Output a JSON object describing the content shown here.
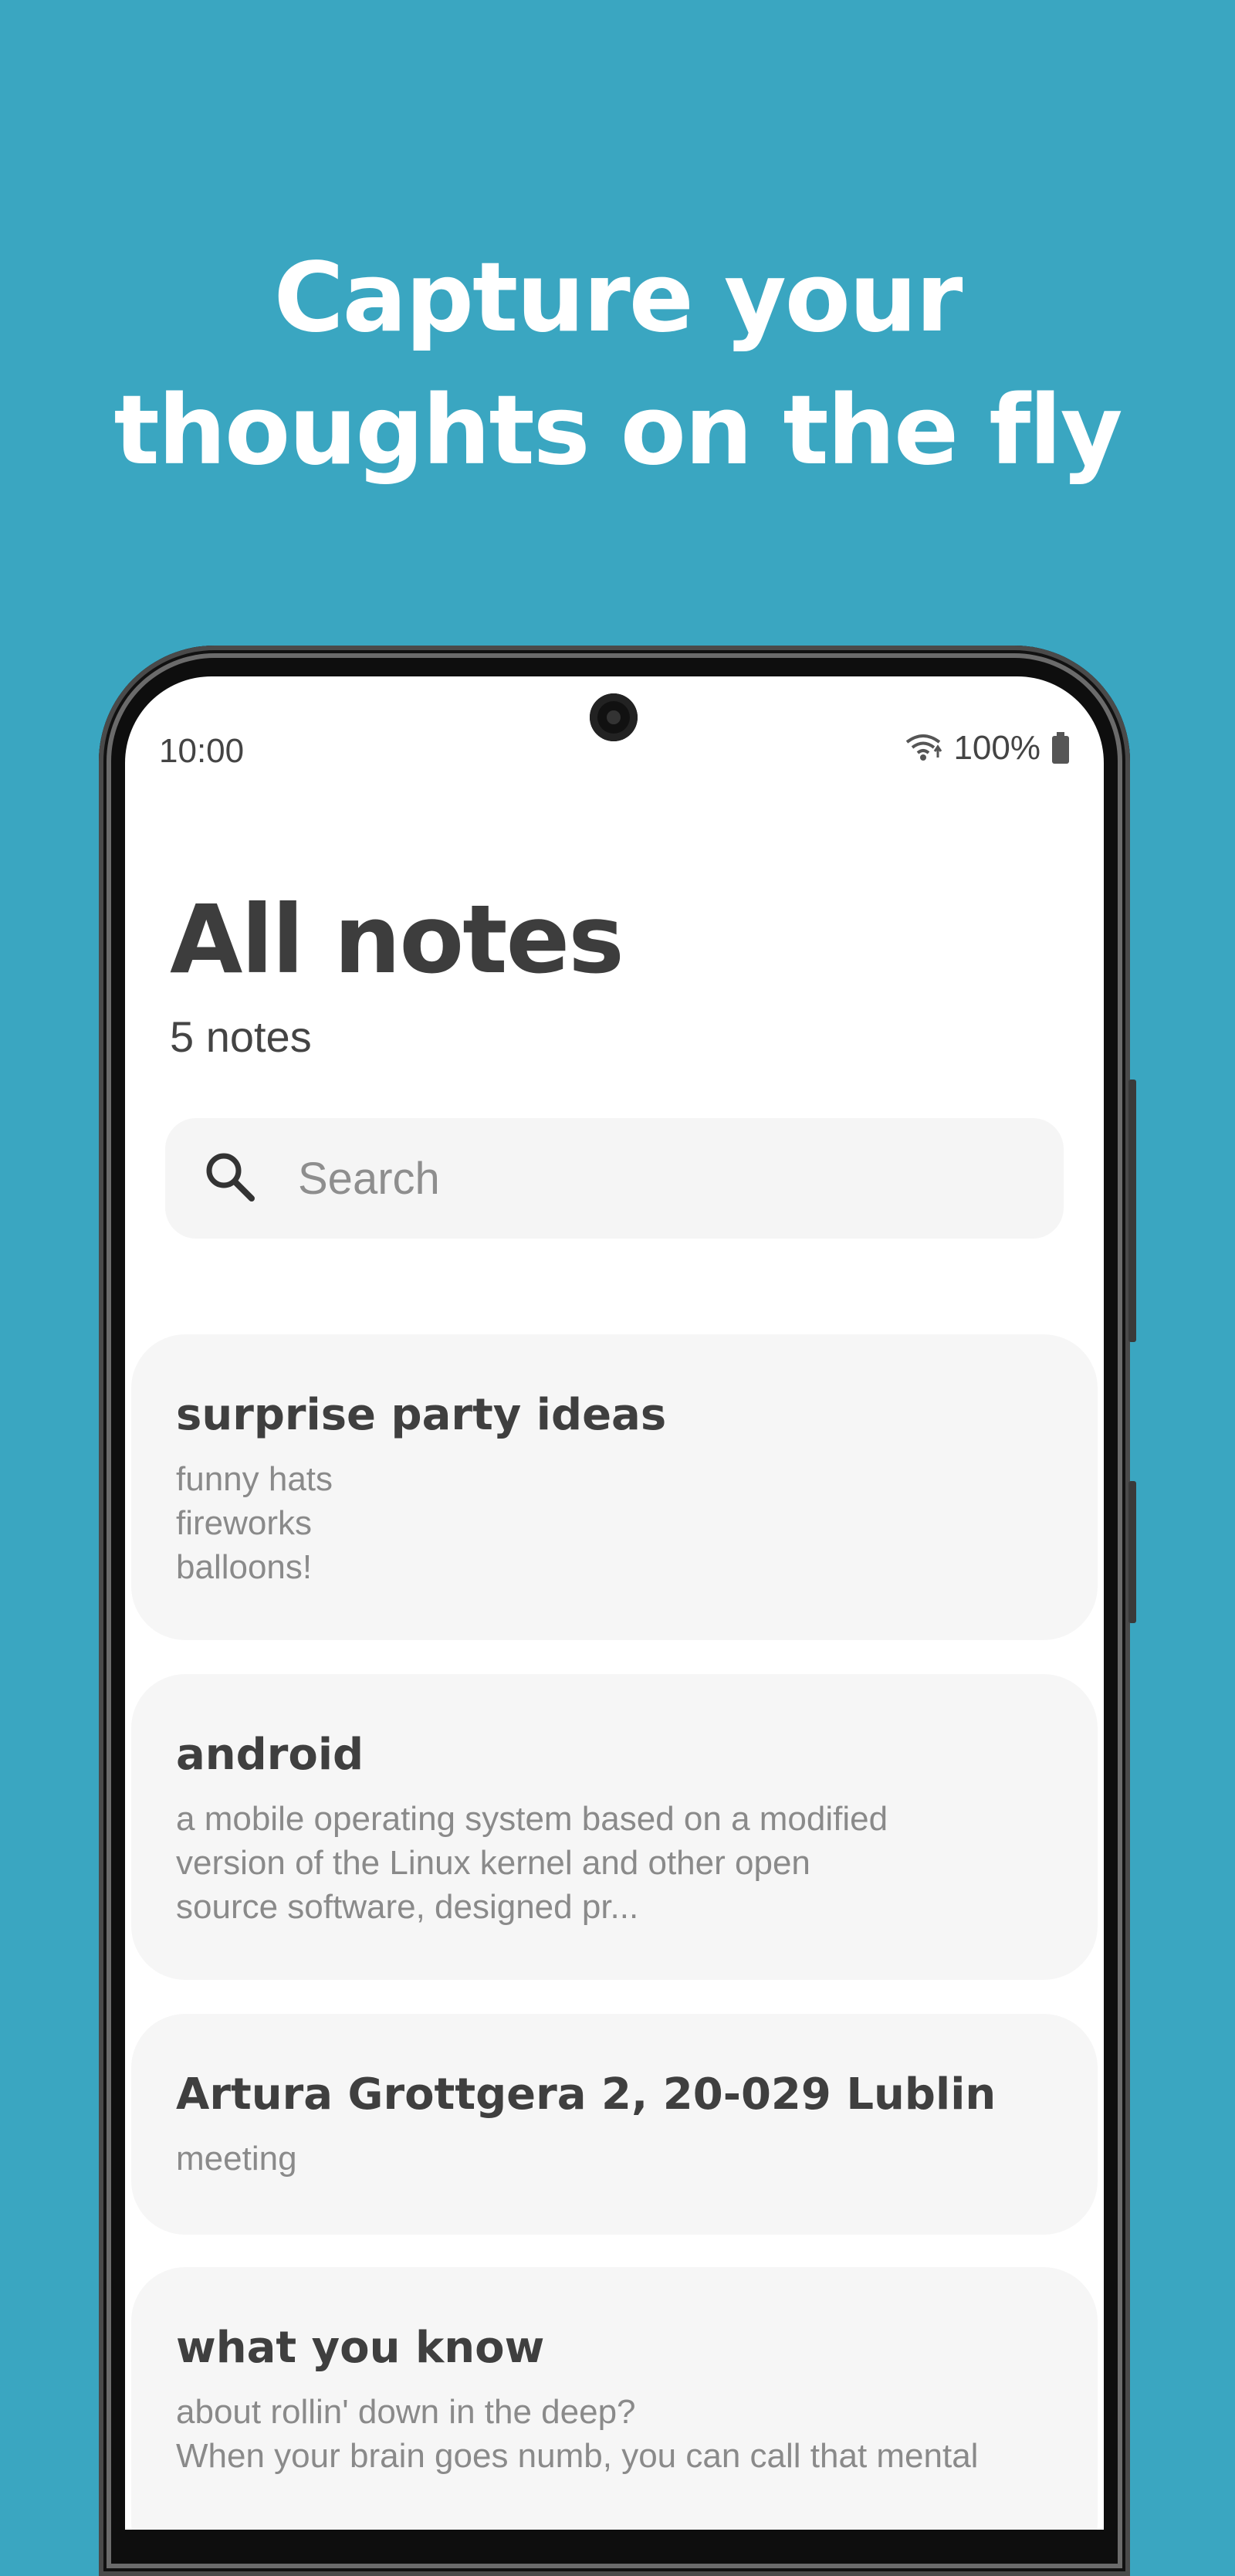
{
  "headline": {
    "line1": "Capture your",
    "line2": "thoughts on the fly"
  },
  "status_bar": {
    "time": "10:00",
    "battery": "100%"
  },
  "page": {
    "title": "All notes",
    "count": "5 notes"
  },
  "search": {
    "placeholder": "Search"
  },
  "notes": [
    {
      "title": "surprise party ideas",
      "body": "funny hats\nfireworks\nballoons!"
    },
    {
      "title": "android",
      "body": "a mobile operating system based on a modified\nversion of the Linux kernel and other open\nsource software, designed pr..."
    },
    {
      "title": "Artura Grottgera 2, 20-029 Lublin",
      "body": "meeting"
    },
    {
      "title": "what you know",
      "body": "about rollin' down in the deep?\nWhen your brain goes numb, you can call that mental"
    }
  ],
  "colors": {
    "background": "#3aa6c1",
    "card": "#f6f6f6",
    "title_text": "#3d3d3d",
    "body_text": "#8a8a8a"
  }
}
